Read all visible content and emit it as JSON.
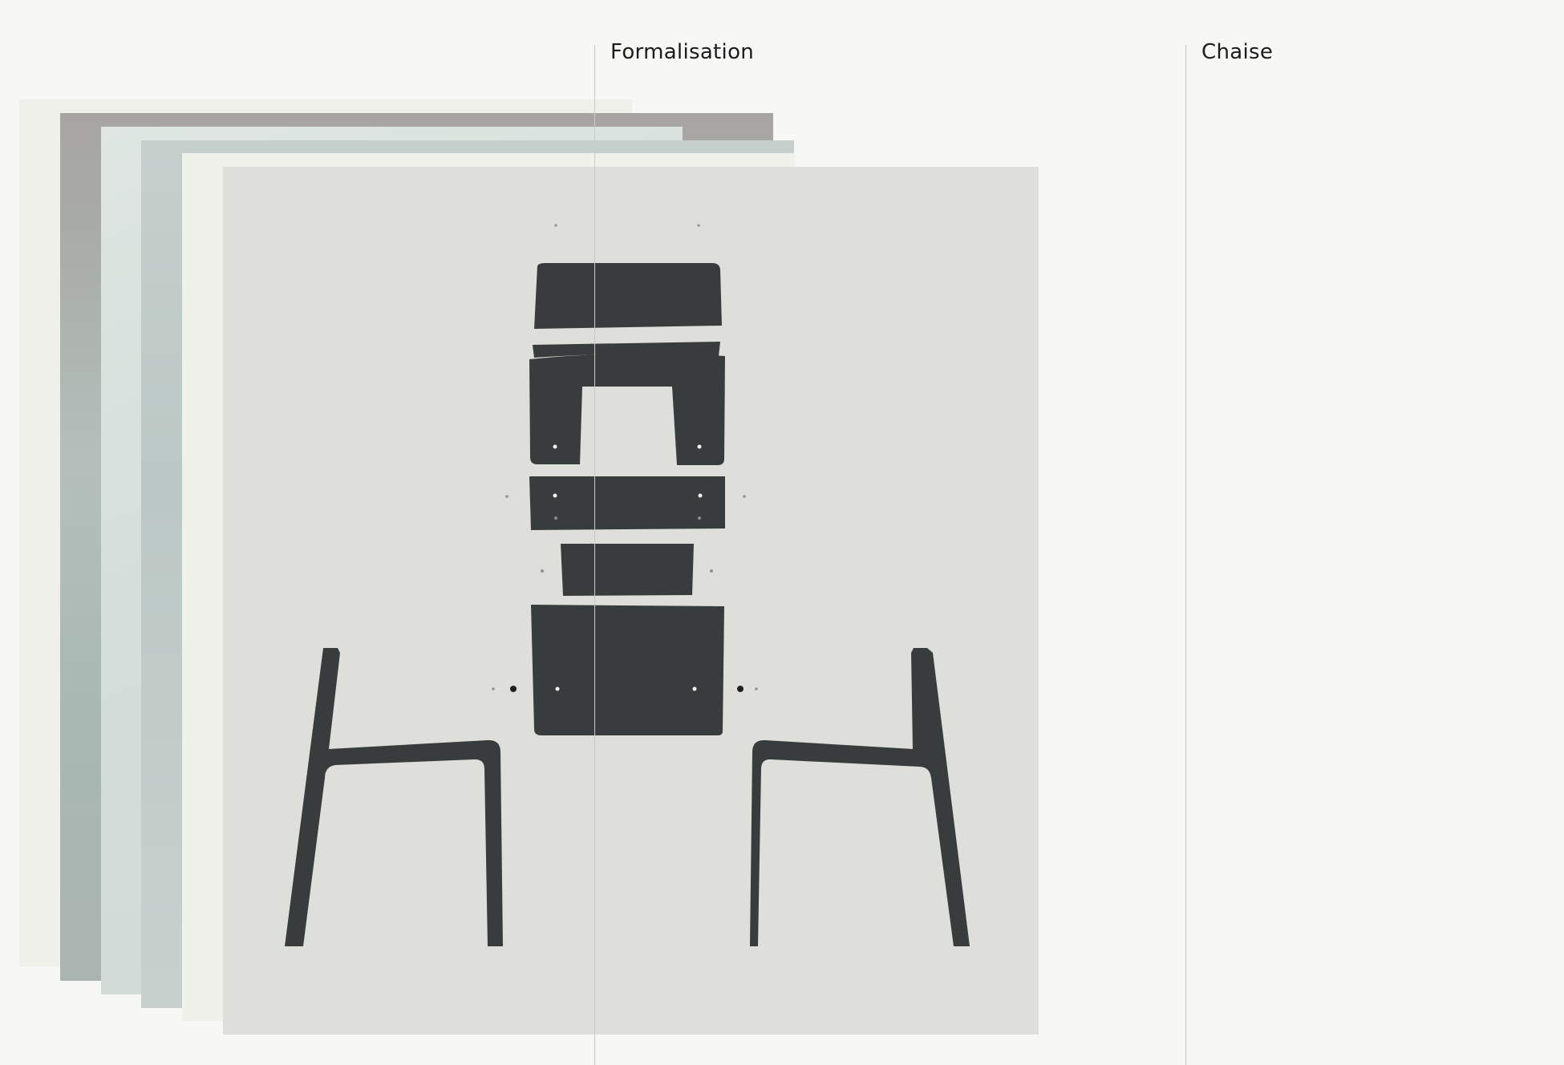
{
  "columns": {
    "left_label": "Formalisation",
    "right_label": "Chaise"
  },
  "stack": {
    "image_count": 6,
    "front_image": {
      "subject": "exploded-chair-parts",
      "part_color": "#393c3c",
      "background_color": "#dededa"
    }
  },
  "colors": {
    "page_background": "#f7f7f6",
    "divider": "#c9c9c6",
    "text": "#1c1c1c"
  }
}
